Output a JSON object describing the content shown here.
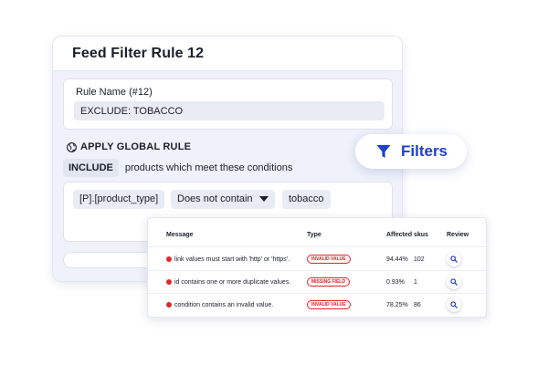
{
  "rule": {
    "title": "Feed Filter Rule 12",
    "name_label": "Rule Name (#12)",
    "name_value": "EXCLUDE: TOBACCO",
    "global_icon": "globe-icon",
    "global_label": "APPLY GLOBAL RULE",
    "include_chip": "INCLUDE",
    "include_text": "products which meet these conditions",
    "condition": {
      "field": "[P].[product_type]",
      "operator": "Does not contain",
      "value": "tobacco"
    }
  },
  "filters_button": {
    "label": "Filters",
    "icon": "filter-icon",
    "color": "#1f3fd0"
  },
  "errors_table": {
    "columns": {
      "message": "Message",
      "type": "Type",
      "affected": "Affected skus",
      "review": "Review"
    },
    "rows": [
      {
        "message": "link values must start with 'http' or 'https'.",
        "type": "INVALID VALUE",
        "percent": "94.44%",
        "count": "102"
      },
      {
        "message": "id contains one or more duplicate values.",
        "type": "MISSING FIELD",
        "percent": "0.93%",
        "count": "1"
      },
      {
        "message": "condition contains an invalid value.",
        "type": "INVALID VALUE",
        "percent": "78.25%",
        "count": "86"
      }
    ],
    "status_color": "#e0282e"
  }
}
